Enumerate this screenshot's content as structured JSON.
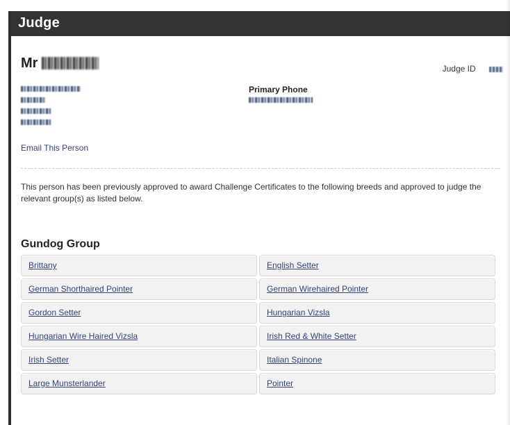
{
  "header": {
    "title": "Judge"
  },
  "judge": {
    "title_prefix": "Mr",
    "id_label": "Judge ID"
  },
  "contact": {
    "phone_label": "Primary Phone",
    "email_link": "Email This Person"
  },
  "intro_text": "This person has been previously approved to award Challenge Certificates to the following breeds and approved to judge the relevant group(s) as listed below.",
  "group": {
    "title": "Gundog Group",
    "breeds": [
      "Brittany",
      "English Setter",
      "German Shorthaired Pointer",
      "German Wirehaired Pointer",
      "Gordon Setter",
      "Hungarian Vizsla",
      "Hungarian Wire Haired Vizsla",
      "Irish Red & White Setter",
      "Irish Setter",
      "Italian Spinone",
      "Large Munsterlander",
      "Pointer"
    ]
  }
}
